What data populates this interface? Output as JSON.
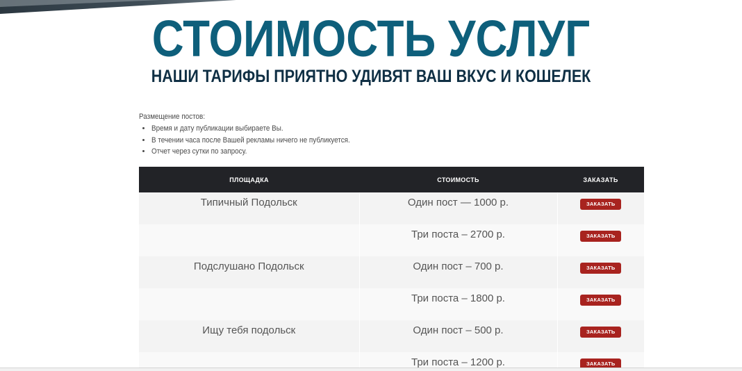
{
  "hero": {
    "title": "СТОИМОСТЬ УСЛУГ",
    "subtitle": "НАШИ ТАРИФЫ ПРИЯТНО УДИВЯТ ВАШ ВКУС И КОШЕЛЕК"
  },
  "intro": {
    "title": "Размещение постов:",
    "items": [
      "Время и дату публикации выбираете Вы.",
      "В течении часа после Вашей рекламы ничего не публикуется.",
      "Отчет через сутки по запросу."
    ]
  },
  "table": {
    "headers": [
      "ПЛОЩАДКА",
      "СТОИМОСТЬ",
      "ЗАКАЗАТЬ"
    ],
    "rows": [
      {
        "platform": "Типичный Подольск",
        "price": "Один пост  — 1000 р.",
        "action": "ЗАКАЗАТЬ"
      },
      {
        "platform": "",
        "price": "Три поста – 2700 р.",
        "action": "ЗАКАЗАТЬ"
      },
      {
        "platform": "Подслушано Подольск",
        "price": "Один пост – 700 р.",
        "action": "ЗАКАЗАТЬ"
      },
      {
        "platform": "",
        "price": "Три поста – 1800 р.",
        "action": "ЗАКАЗАТЬ"
      },
      {
        "platform": "Ищу тебя подольск",
        "price": "Один пост – 500 р.",
        "action": "ЗАКАЗАТЬ"
      },
      {
        "platform": "",
        "price": "Три поста – 1200 р.",
        "action": "ЗАКАЗАТЬ"
      }
    ]
  },
  "colors": {
    "title": "#0e5f7b",
    "subtitle": "#0f2f44",
    "header_bg": "#222327",
    "button_bg": "#a8231f"
  }
}
